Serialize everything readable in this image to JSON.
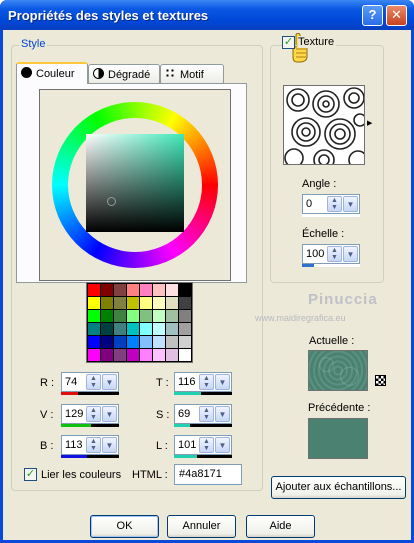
{
  "window": {
    "title": "Propriétés des styles et textures",
    "help_glyph": "?",
    "close_glyph": "✕"
  },
  "style_group": {
    "label": "Style",
    "tabs": [
      {
        "label": "Couleur",
        "icon": "color-dot-icon"
      },
      {
        "label": "Dégradé",
        "icon": "gradient-icon"
      },
      {
        "label": "Motif",
        "icon": "pattern-icon"
      }
    ],
    "palette_colors": [
      "#ff0000",
      "#800000",
      "#804040",
      "#ff8080",
      "#ff80c0",
      "#ffc0c0",
      "#ffe0e0",
      "#000000",
      "#ffff00",
      "#808000",
      "#808040",
      "#c0c000",
      "#ffff80",
      "#ffffc0",
      "#e0e0c0",
      "#404040",
      "#00ff00",
      "#008000",
      "#408040",
      "#80ff80",
      "#80c080",
      "#c0ffc0",
      "#a0c0a0",
      "#808080",
      "#008080",
      "#004040",
      "#408080",
      "#00c0c0",
      "#80ffff",
      "#c0ffff",
      "#a0c0c0",
      "#a0a0a0",
      "#0000ff",
      "#000080",
      "#0040c0",
      "#0080ff",
      "#80c0ff",
      "#c0e0ff",
      "#c0c0c0",
      "#d0d0d0",
      "#ff00ff",
      "#800080",
      "#804080",
      "#c000c0",
      "#ff80ff",
      "#ffc0ff",
      "#e0c0e0",
      "#ffffff"
    ],
    "rgb": [
      {
        "label": "R :",
        "value": "74",
        "bar_fraction": 0.29,
        "bar_color": "#e01010"
      },
      {
        "label": "V :",
        "value": "129",
        "bar_fraction": 0.51,
        "bar_color": "#10c010"
      },
      {
        "label": "B :",
        "value": "113",
        "bar_fraction": 0.44,
        "bar_color": "#1010e0"
      }
    ],
    "tsl": [
      {
        "label": "T :",
        "value": "116",
        "bar_fraction": 0.46,
        "bar_color": "#20d0b0"
      },
      {
        "label": "S :",
        "value": "69",
        "bar_fraction": 0.27,
        "bar_color": "#20d0b0"
      },
      {
        "label": "L :",
        "value": "101",
        "bar_fraction": 0.4,
        "bar_color": "#20d0b0"
      }
    ],
    "link_colors": {
      "label": "Lier les couleurs",
      "checked": true,
      "check_glyph": "✓"
    },
    "html": {
      "label": "HTML :",
      "value": "#4a8171"
    }
  },
  "texture_group": {
    "label": "Texture",
    "checked": true,
    "check_glyph": "✓",
    "angle": {
      "label": "Angle :",
      "value": "0",
      "bar_fraction": 0
    },
    "scale": {
      "label": "Échelle :",
      "value": "100",
      "bar_fraction": 0.2
    }
  },
  "watermark": {
    "name": "Pinuccia",
    "url": "www.maidiregrafica.eu"
  },
  "current": {
    "label": "Actuelle :",
    "color": "#4a8171"
  },
  "previous": {
    "label": "Précédente :",
    "color": "#4a8171"
  },
  "add_samples_button": "Ajouter aux échantillons...",
  "footer": {
    "ok": "OK",
    "cancel": "Annuler",
    "help": "Aide"
  },
  "colors": {
    "accent": "#0046d5",
    "current_color": "#4a8171"
  }
}
